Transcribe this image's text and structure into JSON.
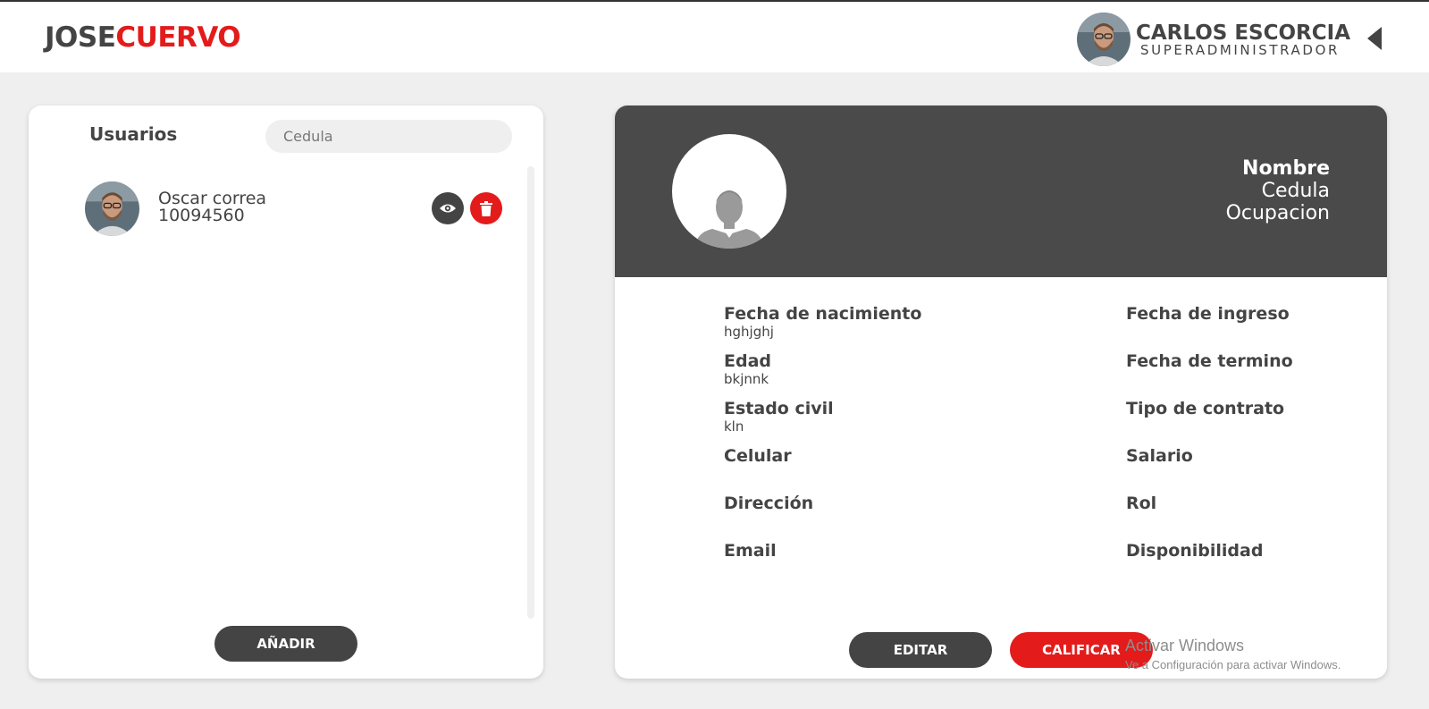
{
  "header": {
    "logo_part1": "JOSE",
    "logo_part2": "CUERVO",
    "user": {
      "name": "CARLOS ESCORCIA",
      "role": "SUPERADMINISTRADOR"
    }
  },
  "users_panel": {
    "title": "Usuarios",
    "search_placeholder": "Cedula",
    "items": [
      {
        "name": "Oscar correa",
        "cedula": "10094560"
      }
    ],
    "add_label": "AÑADIR"
  },
  "profile": {
    "name_label": "Nombre",
    "cedula_label": "Cedula",
    "occupation_label": "Ocupacion",
    "left_fields": [
      {
        "label": "Fecha de nacimiento",
        "value": "hghjghj"
      },
      {
        "label": "Edad",
        "value": "bkjnnk"
      },
      {
        "label": "Estado civil",
        "value": "kln"
      },
      {
        "label": "Celular",
        "value": ""
      },
      {
        "label": "Dirección",
        "value": ""
      },
      {
        "label": "Email",
        "value": ""
      }
    ],
    "right_fields": [
      {
        "label": "Fecha de ingreso",
        "value": ""
      },
      {
        "label": "Fecha de termino",
        "value": ""
      },
      {
        "label": "Tipo de contrato",
        "value": ""
      },
      {
        "label": "Salario",
        "value": ""
      },
      {
        "label": "Rol",
        "value": ""
      },
      {
        "label": "Disponibilidad",
        "value": ""
      }
    ],
    "edit_label": "EDITAR",
    "rate_label": "CALIFICAR"
  },
  "watermark": {
    "line1": "Activar Windows",
    "line2": "Ve a Configuración para activar Windows."
  },
  "colors": {
    "accent": "#e31b1b",
    "dark": "#444444",
    "header_dark": "#4a4a4a",
    "background": "#efefef"
  }
}
